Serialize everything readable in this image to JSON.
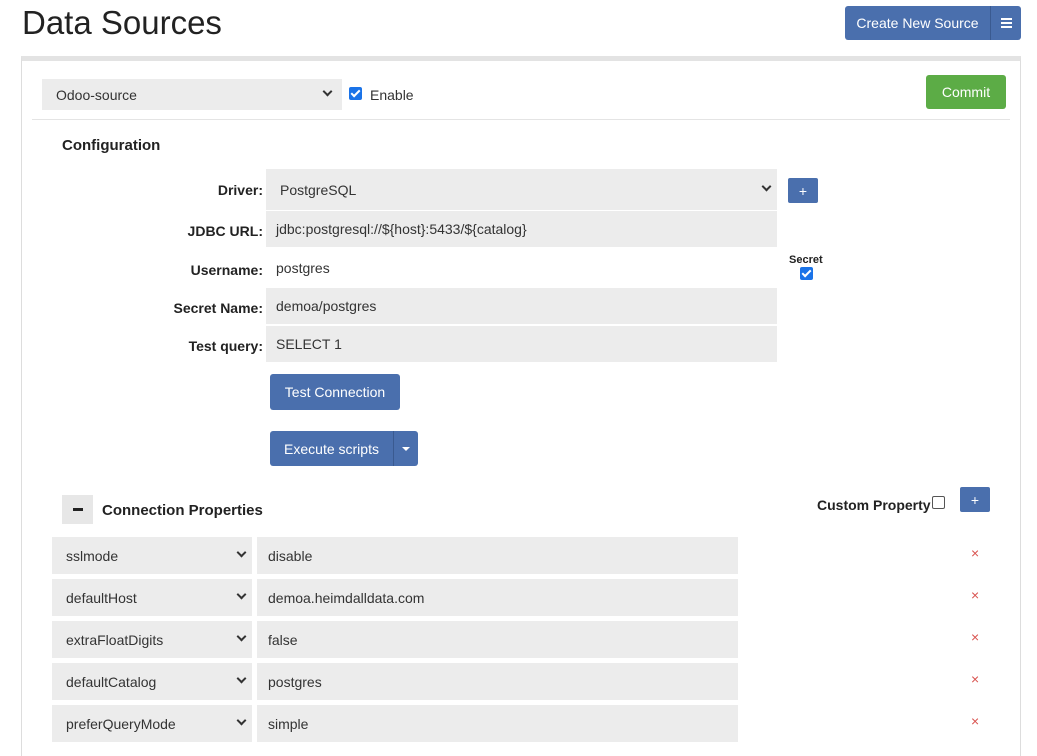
{
  "header": {
    "title": "Data Sources",
    "create_label": "Create New Source",
    "menu_icon": "hamburger-icon"
  },
  "source": {
    "selected": "Odoo-source",
    "enable_label": "Enable",
    "enable_checked": true,
    "commit_label": "Commit"
  },
  "config": {
    "title": "Configuration",
    "driver_label": "Driver:",
    "driver_value": "PostgreSQL",
    "plus_label": "+",
    "jdbc_label": "JDBC URL:",
    "jdbc_value": "jdbc:postgresql://${host}:5433/${catalog}",
    "username_label": "Username:",
    "username_value": "postgres",
    "secret_label": "Secret",
    "secret_checked": true,
    "secret_name_label": "Secret Name:",
    "secret_name_value": "demoa/postgres",
    "test_query_label": "Test query:",
    "test_query_value": "SELECT 1",
    "test_connection_label": "Test Connection",
    "execute_scripts_label": "Execute scripts"
  },
  "connection_properties": {
    "title": "Connection Properties",
    "custom_property_label": "Custom Property",
    "custom_property_checked": false,
    "plus_label": "+",
    "delete_icon": "×",
    "rows": [
      {
        "key": "sslmode",
        "value": "disable"
      },
      {
        "key": "defaultHost",
        "value": "demoa.heimdalldata.com"
      },
      {
        "key": "extraFloatDigits",
        "value": "false"
      },
      {
        "key": "defaultCatalog",
        "value": "postgres"
      },
      {
        "key": "preferQueryMode",
        "value": "simple"
      }
    ]
  },
  "colors": {
    "primary": "#4a6fad",
    "success": "#5cac46",
    "danger": "#d9534f",
    "field_bg": "#ececec"
  }
}
